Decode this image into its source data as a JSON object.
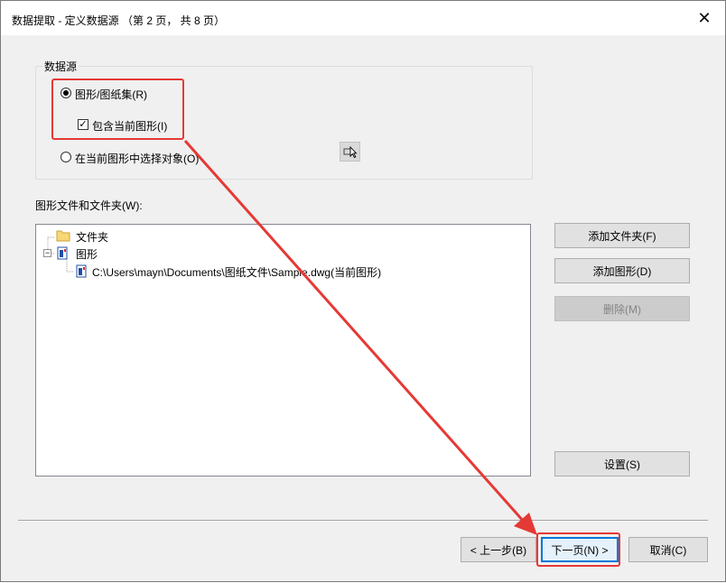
{
  "window": {
    "title": "数据提取 - 定义数据源 （第 2 页， 共 8 页）",
    "close_glyph": "✕"
  },
  "datasource": {
    "group_title": "数据源",
    "option_drawing_sheetset": "图形/图纸集(R)",
    "include_current_drawing": "包含当前图形(I)",
    "option_select_objects": "在当前图形中选择对象(O)",
    "selected_option": "drawing_sheetset",
    "include_current_checked": true
  },
  "files": {
    "section_label": "图形文件和文件夹(W):",
    "tree": {
      "folder_label": "文件夹",
      "drawings_label": "图形",
      "drawing_file": "C:\\Users\\mayn\\Documents\\图纸文件\\Sample.dwg(当前图形)"
    }
  },
  "side_buttons": {
    "add_folder": "添加文件夹(F)",
    "add_drawing": "添加图形(D)",
    "remove": "删除(M)",
    "settings": "设置(S)"
  },
  "footer": {
    "back": "< 上一步(B)",
    "next": "下一页(N) >",
    "cancel": "取消(C)"
  },
  "colors": {
    "highlight": "#e53935",
    "primary_border": "#0078d7"
  }
}
